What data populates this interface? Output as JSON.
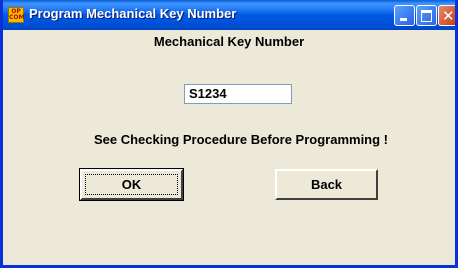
{
  "window": {
    "title": "Program Mechanical Key Number",
    "app_icon": {
      "line1": "OP",
      "line2": "COM"
    },
    "controls": {
      "minimize": "minimize-icon",
      "maximize": "maximize-icon",
      "close": "✕"
    }
  },
  "dialog": {
    "heading": "Mechanical Key Number",
    "key_field_value": "S1234",
    "notice": "See Checking Procedure Before Programming !",
    "ok_label": "OK",
    "back_label": "Back"
  },
  "colors": {
    "title_bar": "#0059e3",
    "client_background": "#ece9d8",
    "close_button": "#c8401a"
  }
}
